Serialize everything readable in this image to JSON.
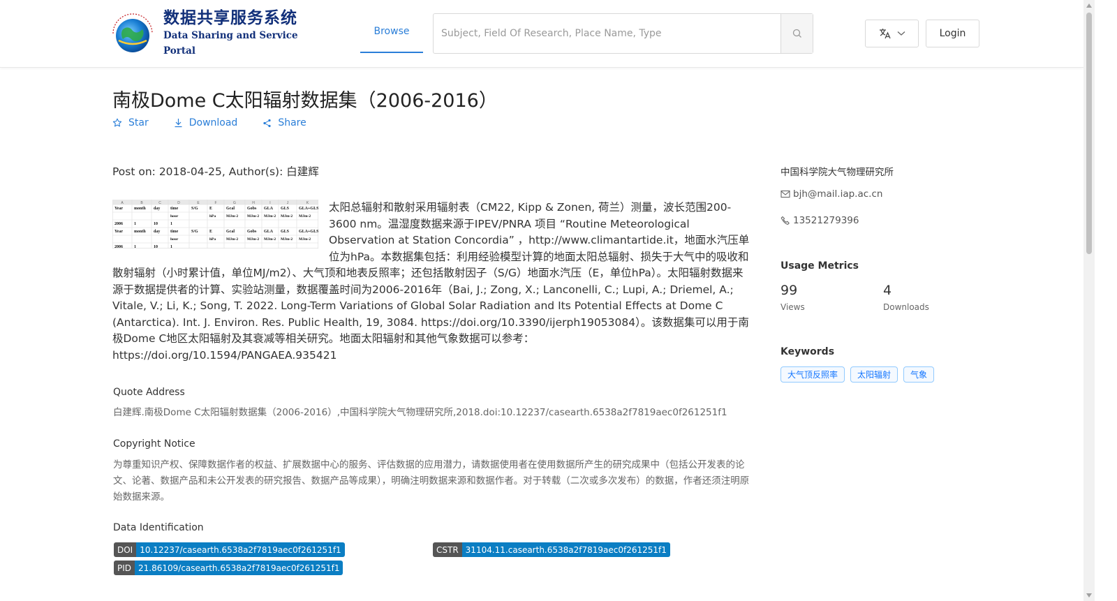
{
  "header": {
    "logo_cn": "数据共享服务系统",
    "logo_en": "Data Sharing and Service Portal",
    "nav_browse": "Browse",
    "search_placeholder": "Subject, Field Of Research, Place Name, Type",
    "login": "Login"
  },
  "dataset": {
    "title": "南极Dome C太阳辐射数据集（2006-2016）",
    "actions": {
      "star": "Star",
      "download": "Download",
      "share": "Share"
    },
    "post_meta": "Post on: 2018-04-25, Author(s): 白建辉",
    "abstract": "太阳总辐射和散射采用辐射表（CM22, Kipp & Zonen, 荷兰）测量，波长范围200-3600 nm。温湿度数据来源于IPEV/PNRA 项目 “Routine Meteorological Observation at Station Concordia” ，http://www.climantartide.it，地面水汽压单位为hPa。本数据集包括：利用经验模型计算的地面太阳总辐射、损失于大气中的吸收和散射辐射（小时累计值，单位MJ/m2）、大气顶和地表反照率；还包括散射因子（S/G）地面水汽压（E，单位hPa）。太阳辐射数据来源于数据提供者的计算、实验站测量，数据覆盖时间为2006-2016年（Bai, J.; Zong, X.; Lanconelli, C.; Lupi, A.; Driemel, A.; Vitale, V.; Li, K.; Song, T. 2022. Long-Term Variations of Global Solar Radiation and Its Potential Effects at Dome C (Antarctica). Int. J. Environ. Res. Public Health, 19, 3084. https://doi.org/10.3390/ijerph19053084）。该数据集可以用于南极Dome C地区太阳辐射及其衰减等相关研究。地面太阳辐射和其他气象数据可以参考：https://doi.org/10.1594/PANGAEA.935421",
    "quote_heading": "Quote Address",
    "quote_text": "白建辉.南极Dome C太阳辐射数据集（2006-2016）,中国科学院大气物理研究所,2018.doi:10.12237/casearth.6538a2f7819aec0f261251f1",
    "copyright_heading": "Copyright Notice",
    "copyright_text": "为尊重知识产权、保障数据作者的权益、扩展数据中心的服务、评估数据的应用潜力，请数据使用者在使用数据所产生的研究成果中（包括公开发表的论文、论著、数据产品和未公开发表的研究报告、数据产品等成果），明确注明数据来源和数据作者。对于转载（二次或多次发布）的数据，作者还须注明原始数据来源。",
    "identification_heading": "Data Identification",
    "identifiers": {
      "doi_key": "DOI",
      "doi_value": "10.12237/casearth.6538a2f7819aec0f261251f1",
      "cstr_key": "CSTR",
      "cstr_value": "31104.11.casearth.6538a2f7819aec0f261251f1",
      "pid_key": "PID",
      "pid_value": "21.86109/casearth.6538a2f7819aec0f261251f1"
    }
  },
  "sidebar": {
    "organization": "中国科学院大气物理研究所",
    "email": "bjh@mail.iap.ac.cn",
    "phone": "13521279396",
    "usage_heading": "Usage Metrics",
    "views_count": "99",
    "views_label": "Views",
    "downloads_count": "4",
    "downloads_label": "Downloads",
    "keywords_heading": "Keywords",
    "keywords": [
      "大气顶反照率",
      "太阳辐射",
      "气象"
    ]
  },
  "thumbnail": {
    "row1": [
      "Year",
      "month",
      "day",
      "time",
      "S/G",
      "E",
      "Gcal",
      "Gobs",
      "GLA",
      "GLS",
      "GLA+GLS"
    ],
    "row1b": [
      "hour",
      "hPa",
      "MJm-2",
      "MJm-2",
      "MJm-2",
      "MJm-2",
      "MJm-2"
    ],
    "row2": [
      "2006",
      "1",
      "10",
      "1"
    ],
    "cols": [
      "A",
      "B",
      "C",
      "D",
      "E",
      "F",
      "G",
      "H",
      "I",
      "J",
      "K"
    ]
  },
  "colors": {
    "accent": "#2a7ed8",
    "badge_key": "#555555",
    "badge_value": "#0b7ec3",
    "logo": "#12307a"
  }
}
